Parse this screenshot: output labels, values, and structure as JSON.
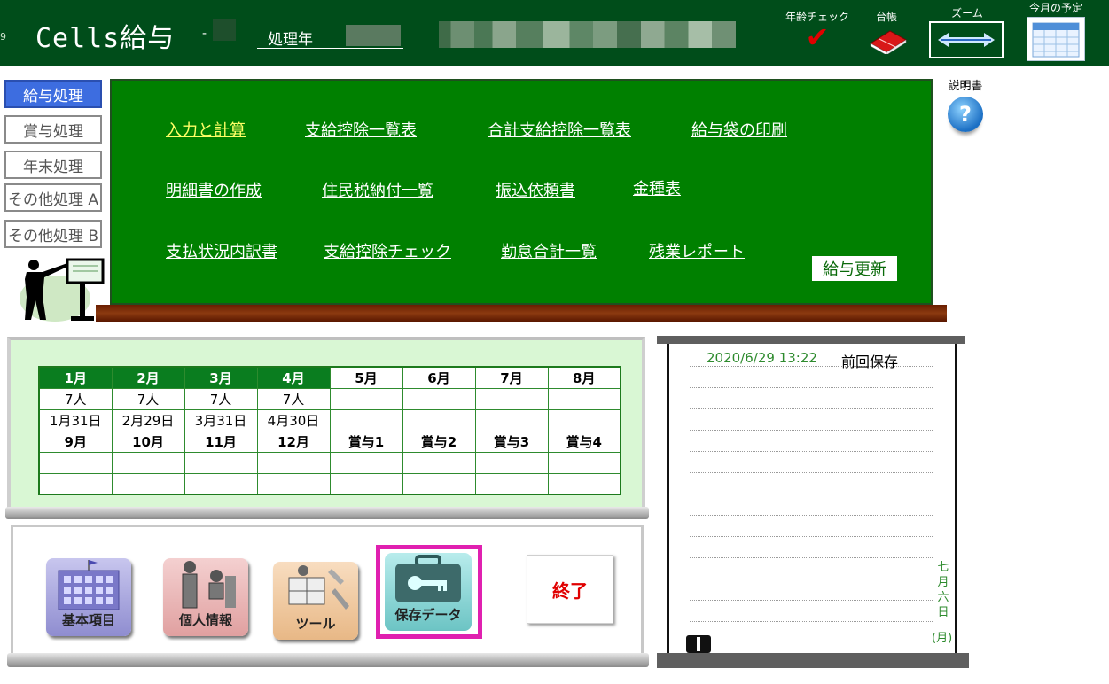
{
  "header": {
    "num_prefix": "9",
    "app_title": "Cells給与",
    "dash": "-",
    "process_year_label": "処理年",
    "tools": {
      "age_check": "年齢チェック",
      "ledger": "台帳",
      "zoom": "ズーム",
      "month_schedule": "今月の予定"
    }
  },
  "sidebar": {
    "items": [
      {
        "label": "給与処理",
        "active": true
      },
      {
        "label": "賞与処理",
        "active": false
      },
      {
        "label": "年末処理",
        "active": false
      },
      {
        "label": "その他処理 A",
        "active": false
      },
      {
        "label": "その他処理 B",
        "active": false
      }
    ]
  },
  "board": {
    "links": [
      [
        "入力と計算",
        "支給控除一覧表",
        "合計支給控除一覧表",
        "給与袋の印刷"
      ],
      [
        "明細書の作成",
        "住民税納付一覧",
        "振込依頼書",
        "金種表"
      ],
      [
        "支払状況内訳書",
        "支給控除チェック",
        "勤怠合計一覧",
        "残業レポート"
      ]
    ],
    "update_button": "給与更新"
  },
  "manual": {
    "label": "説明書",
    "icon": "?"
  },
  "months_table": {
    "row1_headers": [
      "1月",
      "2月",
      "3月",
      "4月",
      "5月",
      "6月",
      "7月",
      "8月"
    ],
    "row1_counts": [
      "7人",
      "7人",
      "7人",
      "7人",
      "",
      "",
      "",
      ""
    ],
    "row1_dates": [
      "1月31日",
      "2月29日",
      "3月31日",
      "4月30日",
      "",
      "",
      "",
      ""
    ],
    "row2_headers": [
      "9月",
      "10月",
      "11月",
      "12月",
      "賞与1",
      "賞与2",
      "賞与3",
      "賞与4"
    ],
    "done_count": 4
  },
  "icons": {
    "basic": "基本項目",
    "personal": "個人情報",
    "tool": "ツール",
    "save": "保存データ",
    "exit": "終了"
  },
  "notes": {
    "saved_datetime": "2020/6/29 13:22",
    "saved_label": "前回保存",
    "date_vertical": [
      "七",
      "月",
      "六",
      "日"
    ],
    "weekday": "(月)"
  },
  "colors": {
    "header_bg": "#004d1a",
    "board_bg": "#008000",
    "active_tab": "#3d6de0",
    "highlight_link": "#ffff66",
    "save_frame": "#e020b0",
    "exit_text": "#e00000"
  }
}
